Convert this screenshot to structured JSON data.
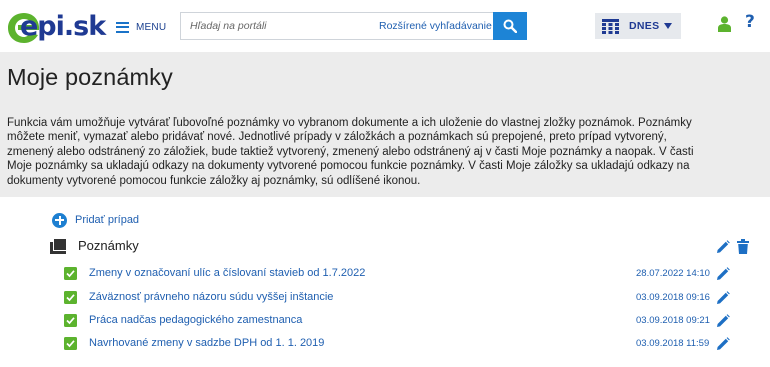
{
  "header": {
    "logo_text": "epi.sk",
    "menu_label": "MENU",
    "search": {
      "placeholder": "Hľadaj na portáli",
      "value": "",
      "advanced_label": "Rozšírené vyhľadávanie"
    },
    "date_selector_label": "DNES",
    "help_label": "?"
  },
  "page": {
    "title": "Moje poznámky",
    "description": [
      "Funkcia vám umožňuje vytvárať ľubovoľné poznámky vo vybranom dokumente a ich uloženie do vlastnej zložky poznámok. Poznámky",
      "môžete meniť, vymazať alebo pridávať nové. Jednotlivé prípady v záložkách a poznámkach sú prepojené, preto prípad vytvorený,",
      "zmenený alebo odstránený zo záložiek, bude taktiež vytvorený, zmenený alebo odstránený aj v časti Moje poznámky a naopak. V časti",
      "Moje poznámky sa ukladajú odkazy na dokumenty vytvorené pomocou funkcie poznámky. V časti Moje záložky sa ukladajú odkazy na",
      "dokumenty vytvorené pomocou funkcie záložky aj poznámky, sú odlíšené ikonou."
    ]
  },
  "content": {
    "add_case_label": "Pridať prípad",
    "folder": {
      "title": "Poznámky",
      "notes": [
        {
          "title": "Zmeny v označovaní ulíc a číslovaní stavieb od 1.7.2022",
          "date": "28.07.2022 14:10"
        },
        {
          "title": "Záväznosť právneho názoru súdu vyššej inštancie",
          "date": "03.09.2018 09:16"
        },
        {
          "title": "Práca nadčas pedagogického zamestnanca",
          "date": "03.09.2018 09:21"
        },
        {
          "title": "Navrhované zmeny v sadzbe DPH od 1. 1. 2019",
          "date": "03.09.2018 11:59"
        }
      ]
    }
  },
  "colors": {
    "brand_blue": "#1f3a93",
    "link_blue": "#1f5fb0",
    "accent_blue": "#1d84d6",
    "brand_green": "#5cb32e",
    "band_gray": "#ececec"
  }
}
